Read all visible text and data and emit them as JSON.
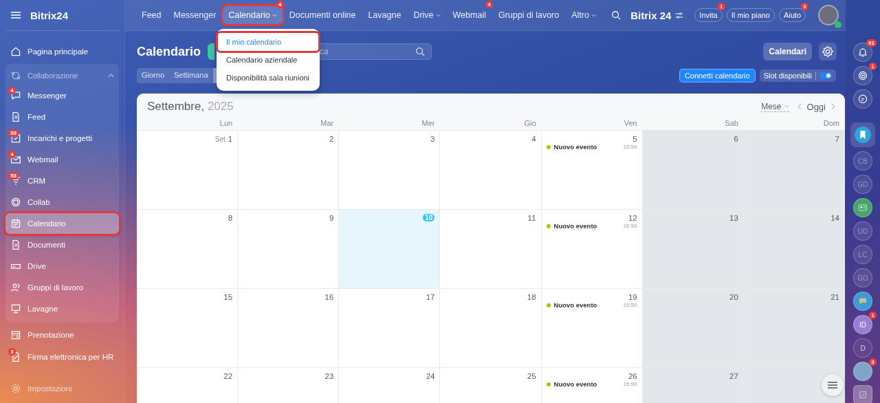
{
  "topbar": {
    "logo": "Bitrix24",
    "nav": [
      {
        "label": "Feed",
        "menu": false,
        "highlighted": false
      },
      {
        "label": "Messenger",
        "menu": false,
        "highlighted": false
      },
      {
        "label": "Calendario",
        "badge": "4",
        "menu": true,
        "highlighted": true
      },
      {
        "label": "Documenti online",
        "menu": false,
        "highlighted": false
      },
      {
        "label": "Lavagne",
        "menu": false,
        "highlighted": false
      },
      {
        "label": "Drive",
        "menu": true,
        "highlighted": false
      },
      {
        "label": "Webmail",
        "badge": "4",
        "menu": false,
        "highlighted": false
      },
      {
        "label": "Gruppi di lavoro",
        "menu": false,
        "highlighted": false
      },
      {
        "label": "Altro",
        "menu": true,
        "highlighted": false
      }
    ],
    "brand": "Bitrix 24",
    "buttons": [
      {
        "label": "Invita",
        "badge": "1"
      },
      {
        "label": "Il mio piano"
      },
      {
        "label": "Aiuto",
        "badge": "3"
      }
    ]
  },
  "dropdown": [
    {
      "label": "Il mio calendario",
      "selected": true,
      "highlighted": true
    },
    {
      "label": "Calendario aziendale",
      "selected": false,
      "highlighted": false
    },
    {
      "label": "Disponibilità sala riunioni",
      "selected": false,
      "highlighted": false
    }
  ],
  "sidebar": {
    "items": [
      {
        "label": "Pagina principale",
        "selected": false,
        "highlighted": false
      }
    ],
    "group": {
      "label": "Collaborazione",
      "expanded": true,
      "children": [
        {
          "label": "Messenger",
          "badge": "4",
          "selected": false,
          "highlighted": false
        },
        {
          "label": "Feed",
          "selected": false,
          "highlighted": false
        },
        {
          "label": "Incarichi e progetti",
          "badge": "39",
          "selected": false,
          "highlighted": false
        },
        {
          "label": "Webmail",
          "badge": "4",
          "selected": false,
          "highlighted": false
        },
        {
          "label": "CRM",
          "badge": "58",
          "selected": false,
          "highlighted": false
        },
        {
          "label": "Collab",
          "selected": false,
          "highlighted": false
        },
        {
          "label": "Calendario",
          "selected": true,
          "highlighted": true
        },
        {
          "label": "Documenti",
          "selected": false,
          "highlighted": false
        },
        {
          "label": "Drive",
          "selected": false,
          "highlighted": false
        },
        {
          "label": "Gruppi di lavoro",
          "selected": false,
          "highlighted": false
        },
        {
          "label": "Lavagne",
          "selected": false,
          "highlighted": false
        }
      ]
    },
    "more": [
      {
        "label": "Prenotazione"
      },
      {
        "label": "Firma elettronica per HR",
        "badge": "3"
      }
    ],
    "settings": "Impostazioni"
  },
  "calendar": {
    "title": "Calendario",
    "search": {
      "placeholder": "ca"
    },
    "calendars_button": "Calendari",
    "connect_button": "Connetti calendario",
    "slots": {
      "label": "Slot disponibili",
      "on": true
    },
    "view_tabs": [
      {
        "label": "Giorno",
        "selected": false
      },
      {
        "label": "Settimana",
        "selected": false
      },
      {
        "selected": true
      }
    ],
    "month": "Settembre,",
    "year": "2025",
    "view_select": "Mese",
    "today_button": "Oggi",
    "weekdays": [
      "Lun",
      "Mar",
      "Mer",
      "Gio",
      "Ven",
      "Sab",
      "Dom"
    ],
    "weeks": [
      [
        {
          "prefix": "Set",
          "day": "1",
          "today": false,
          "weekend": false
        },
        {
          "day": "2",
          "today": false,
          "weekend": false
        },
        {
          "day": "3",
          "today": false,
          "weekend": false
        },
        {
          "day": "4",
          "today": false,
          "weekend": false
        },
        {
          "day": "5",
          "today": false,
          "weekend": false,
          "events": [
            {
              "title": "Nuovo evento",
              "time": "15:50",
              "color": "#9dcf00"
            }
          ]
        },
        {
          "day": "6",
          "today": false,
          "weekend": true
        },
        {
          "day": "7",
          "today": false,
          "weekend": true
        }
      ],
      [
        {
          "day": "8",
          "today": false,
          "weekend": false
        },
        {
          "day": "9",
          "today": false,
          "weekend": false
        },
        {
          "day": "10",
          "today": true,
          "weekend": false
        },
        {
          "day": "11",
          "today": false,
          "weekend": false
        },
        {
          "day": "12",
          "today": false,
          "weekend": false,
          "events": [
            {
              "title": "Nuovo evento",
              "time": "15:50",
              "color": "#9dcf00"
            }
          ]
        },
        {
          "day": "13",
          "today": false,
          "weekend": true
        },
        {
          "day": "14",
          "today": false,
          "weekend": true
        }
      ],
      [
        {
          "day": "15",
          "today": false,
          "weekend": false
        },
        {
          "day": "16",
          "today": false,
          "weekend": false
        },
        {
          "day": "17",
          "today": false,
          "weekend": false
        },
        {
          "day": "18",
          "today": false,
          "weekend": false
        },
        {
          "day": "19",
          "today": false,
          "weekend": false,
          "events": [
            {
              "title": "Nuovo evento",
              "time": "15:50",
              "color": "#9dcf00"
            }
          ]
        },
        {
          "day": "20",
          "today": false,
          "weekend": true
        },
        {
          "day": "21",
          "today": false,
          "weekend": true
        }
      ],
      [
        {
          "day": "22",
          "today": false,
          "weekend": false
        },
        {
          "day": "23",
          "today": false,
          "weekend": false
        },
        {
          "day": "24",
          "today": false,
          "weekend": false
        },
        {
          "day": "25",
          "today": false,
          "weekend": false
        },
        {
          "day": "26",
          "today": false,
          "weekend": false,
          "events": [
            {
              "title": "Nuovo evento",
              "time": "15:50",
              "color": "#9dcf00"
            }
          ]
        },
        {
          "day": "27",
          "today": false,
          "weekend": true
        },
        {
          "today": false,
          "weekend": true
        }
      ]
    ]
  },
  "rail": [
    {
      "kind": "bell",
      "badge": "91"
    },
    {
      "kind": "target",
      "badge": "1"
    },
    {
      "kind": "chat"
    },
    {
      "kind": "bookmark"
    },
    {
      "kind": "initials",
      "label": "CB"
    },
    {
      "kind": "initials",
      "label": "GD"
    },
    {
      "kind": "contact"
    },
    {
      "kind": "initials",
      "label": "UD"
    },
    {
      "kind": "initials",
      "label": "LC"
    },
    {
      "kind": "initials",
      "label": "GD"
    },
    {
      "kind": "group-chat"
    },
    {
      "kind": "initials-active",
      "label": "ID",
      "badge": "1"
    },
    {
      "kind": "initials-faded",
      "label": "D"
    },
    {
      "kind": "avatar",
      "badge": "3"
    },
    {
      "kind": "task"
    }
  ]
}
